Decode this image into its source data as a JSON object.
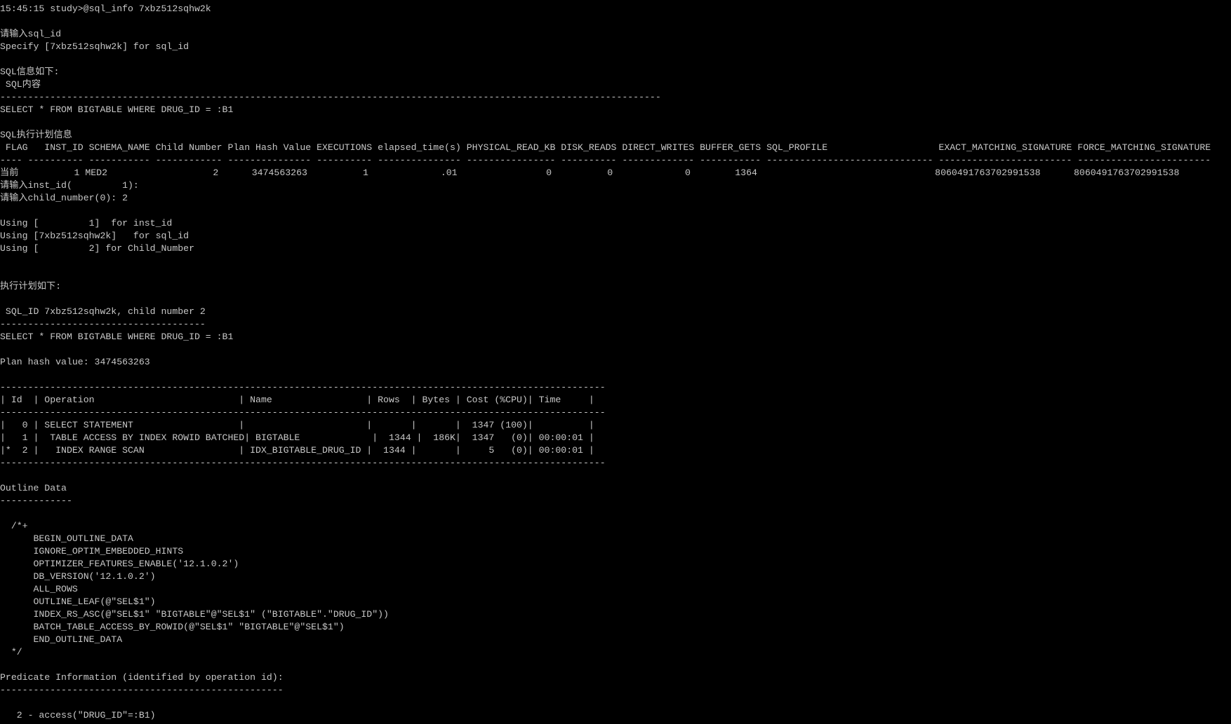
{
  "terminal": {
    "lines": [
      "15:45:15 study>@sql_info 7xbz512sqhw2k",
      "",
      "请输入sql_id",
      "Specify [7xbz512sqhw2k] for sql_id",
      "",
      "SQL信息如下:",
      " SQL内容",
      "-----------------------------------------------------------------------------------------------------------------------",
      "SELECT * FROM BIGTABLE WHERE DRUG_ID = :B1",
      "",
      "SQL执行计划信息",
      " FLAG   INST_ID SCHEMA_NAME Child Number Plan Hash Value EXECUTIONS elapsed_time(s) PHYSICAL_READ_KB DISK_READS DIRECT_WRITES BUFFER_GETS SQL_PROFILE                    EXACT_MATCHING_SIGNATURE FORCE_MATCHING_SIGNATURE",
      "---- ---------- ----------- ------------ --------------- ---------- --------------- ---------------- ---------- ------------- ----------- ------------------------------ ------------------------ ------------------------",
      "当前          1 MED2                   2      3474563263          1             .01                0          0             0        1364                                8060491763702991538      8060491763702991538",
      "请输入inst_id(         1):",
      "请输入child_number(0): 2",
      "",
      "Using [         1]  for inst_id",
      "Using [7xbz512sqhw2k]   for sql_id",
      "Using [         2] for Child_Number",
      "",
      "",
      "执行计划如下:",
      "",
      " SQL_ID 7xbz512sqhw2k, child number 2",
      "-------------------------------------",
      "SELECT * FROM BIGTABLE WHERE DRUG_ID = :B1",
      "",
      "Plan hash value: 3474563263",
      "",
      "-------------------------------------------------------------------------------------------------------------",
      "| Id  | Operation                          | Name                 | Rows  | Bytes | Cost (%CPU)| Time     |",
      "-------------------------------------------------------------------------------------------------------------",
      "|   0 | SELECT STATEMENT                   |                      |       |       |  1347 (100)|          |",
      "|   1 |  TABLE ACCESS BY INDEX ROWID BATCHED| BIGTABLE             |  1344 |  186K|  1347   (0)| 00:00:01 |",
      "|*  2 |   INDEX RANGE SCAN                 | IDX_BIGTABLE_DRUG_ID |  1344 |       |     5   (0)| 00:00:01 |",
      "-------------------------------------------------------------------------------------------------------------",
      "",
      "Outline Data",
      "-------------",
      "",
      "  /*+",
      "      BEGIN_OUTLINE_DATA",
      "      IGNORE_OPTIM_EMBEDDED_HINTS",
      "      OPTIMIZER_FEATURES_ENABLE('12.1.0.2')",
      "      DB_VERSION('12.1.0.2')",
      "      ALL_ROWS",
      "      OUTLINE_LEAF(@\"SEL$1\")",
      "      INDEX_RS_ASC(@\"SEL$1\" \"BIGTABLE\"@\"SEL$1\" (\"BIGTABLE\".\"DRUG_ID\"))",
      "      BATCH_TABLE_ACCESS_BY_ROWID(@\"SEL$1\" \"BIGTABLE\"@\"SEL$1\")",
      "      END_OUTLINE_DATA",
      "  */",
      "",
      "Predicate Information (identified by operation id):",
      "---------------------------------------------------",
      "",
      "   2 - access(\"DRUG_ID\"=:B1)"
    ]
  }
}
